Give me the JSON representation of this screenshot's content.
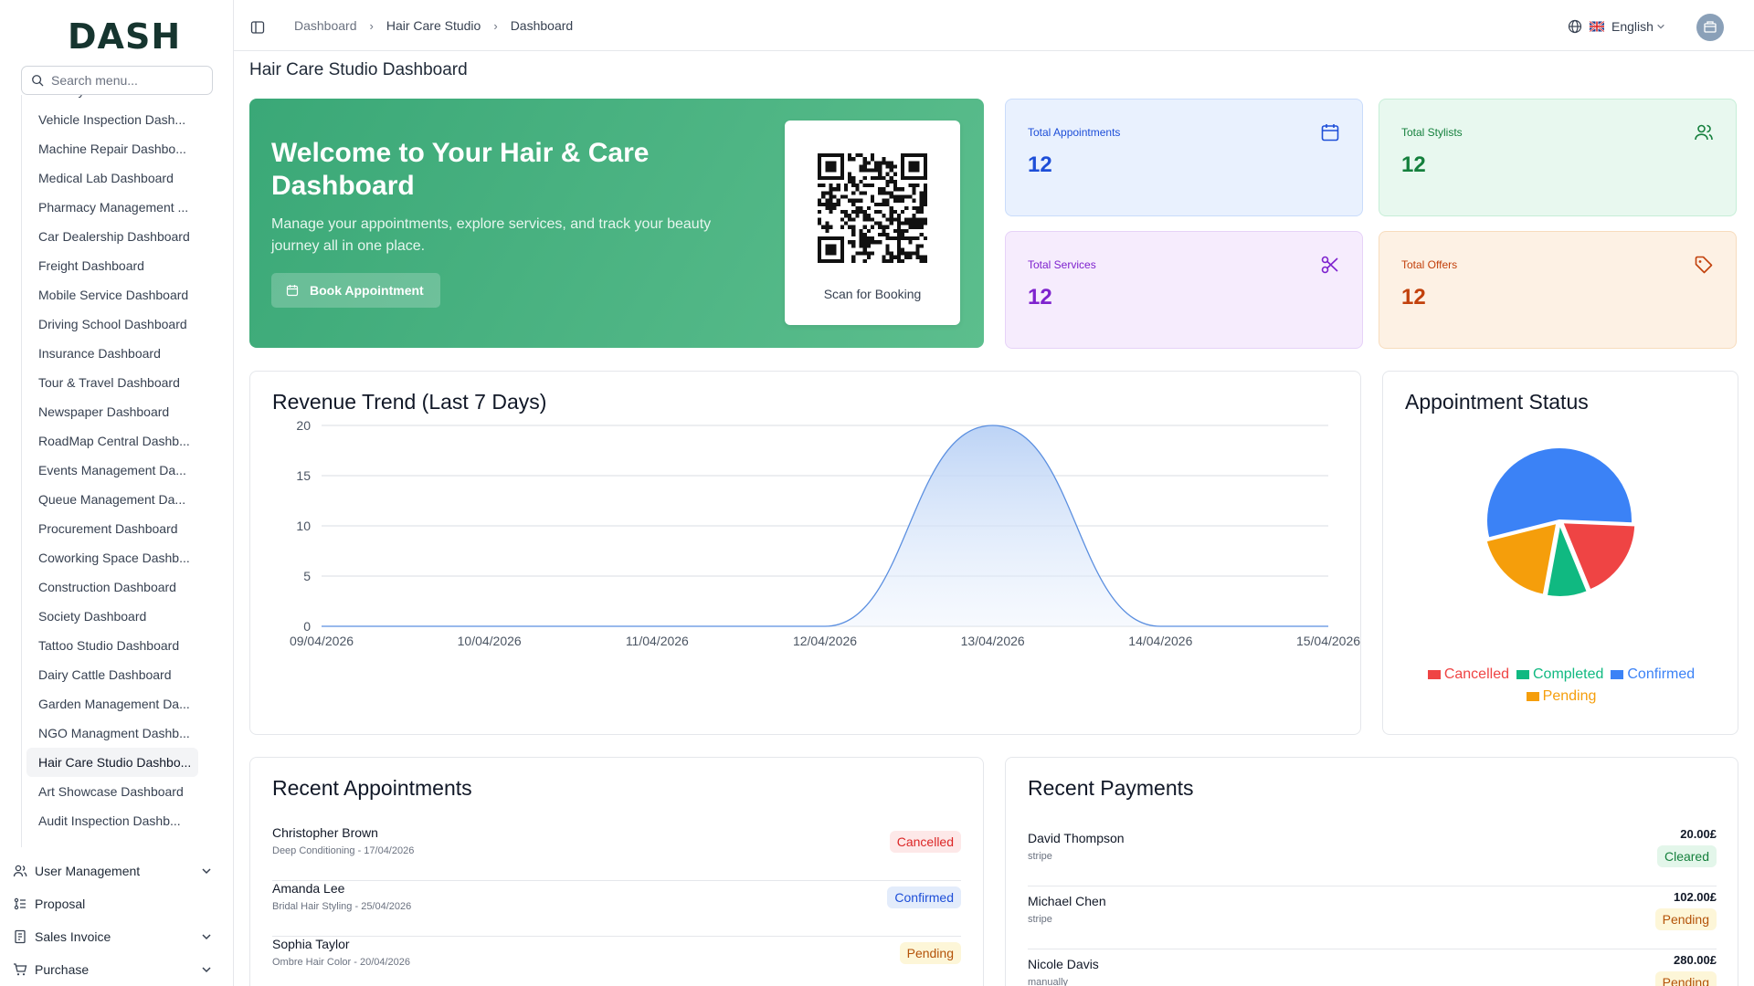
{
  "sidebar": {
    "logo": "DASH",
    "search_placeholder": "Search menu...",
    "partial_item": "Laundry Dashboard",
    "items": [
      "Vehicle Inspection Dash...",
      "Machine Repair Dashbo...",
      "Medical Lab Dashboard",
      "Pharmacy Management ...",
      "Car Dealership Dashboard",
      "Freight Dashboard",
      "Mobile Service Dashboard",
      "Driving School Dashboard",
      "Insurance Dashboard",
      "Tour & Travel Dashboard",
      "Newspaper Dashboard",
      "RoadMap Central Dashb...",
      "Events Management Da...",
      "Queue Management Da...",
      "Procurement Dashboard",
      "Coworking Space Dashb...",
      "Construction Dashboard",
      "Society Dashboard",
      "Tattoo Studio Dashboard",
      "Dairy Cattle Dashboard",
      "Garden Management Da...",
      "NGO Managment Dashb...",
      "Hair Care Studio Dashbo...",
      "Art Showcase Dashboard",
      "Audit Inspection Dashb..."
    ],
    "active_index": 22,
    "groups": {
      "user_management": "User Management",
      "proposal": "Proposal",
      "sales_invoice": "Sales Invoice",
      "purchase": "Purchase"
    }
  },
  "header": {
    "breadcrumb": [
      "Dashboard",
      "Hair Care Studio",
      "Dashboard"
    ],
    "language": "English"
  },
  "page_title": "Hair Care Studio Dashboard",
  "hero": {
    "title": "Welcome to Your Hair & Care Dashboard",
    "subtitle": "Manage your appointments, explore services, and track your beauty journey all in one place.",
    "button": "Book Appointment",
    "qr_label": "Scan for Booking"
  },
  "stats": {
    "appointments": {
      "label": "Total Appointments",
      "value": "12",
      "icon": "calendar-icon"
    },
    "stylists": {
      "label": "Total Stylists",
      "value": "12",
      "icon": "users-icon"
    },
    "services": {
      "label": "Total Services",
      "value": "12",
      "icon": "scissors-icon"
    },
    "offers": {
      "label": "Total Offers",
      "value": "12",
      "icon": "tag-icon"
    }
  },
  "revenue": {
    "title": "Revenue Trend (Last 7 Days)"
  },
  "status_card": {
    "title": "Appointment Status"
  },
  "chart_data": [
    {
      "type": "area",
      "title": "Revenue Trend (Last 7 Days)",
      "x": [
        "09/04/2026",
        "10/04/2026",
        "11/04/2026",
        "12/04/2026",
        "13/04/2026",
        "14/04/2026",
        "15/04/2026"
      ],
      "y_ticks": [
        0,
        5,
        10,
        15,
        20
      ],
      "ylim": [
        0,
        20
      ],
      "series": [
        {
          "values": [
            0,
            0,
            0,
            0,
            20,
            0,
            0
          ]
        }
      ],
      "grid": true,
      "color": "#5b8fe0"
    },
    {
      "type": "pie",
      "title": "Appointment Status",
      "labels": [
        "Cancelled",
        "Completed",
        "Confirmed",
        "Pending"
      ],
      "values": [
        2,
        1,
        6,
        2
      ],
      "colors": [
        "#ef4444",
        "#10b981",
        "#3b82f6",
        "#f59e0b"
      ],
      "legend": "bottom"
    }
  ],
  "recent_appointments": {
    "title": "Recent Appointments",
    "rows": [
      {
        "name": "Christopher Brown",
        "detail": "Deep Conditioning - 17/04/2026",
        "status": "Cancelled"
      },
      {
        "name": "Amanda Lee",
        "detail": "Bridal Hair Styling - 25/04/2026",
        "status": "Confirmed"
      },
      {
        "name": "Sophia Taylor",
        "detail": "Ombre Hair Color - 20/04/2026",
        "status": "Pending"
      }
    ]
  },
  "recent_payments": {
    "title": "Recent Payments",
    "rows": [
      {
        "name": "David Thompson",
        "method": "stripe",
        "amount": "20.00£",
        "status": "Cleared"
      },
      {
        "name": "Michael Chen",
        "method": "stripe",
        "amount": "102.00£",
        "status": "Pending"
      },
      {
        "name": "Nicole Davis",
        "method": "manually",
        "amount": "280.00£",
        "status": "Pending"
      }
    ]
  }
}
